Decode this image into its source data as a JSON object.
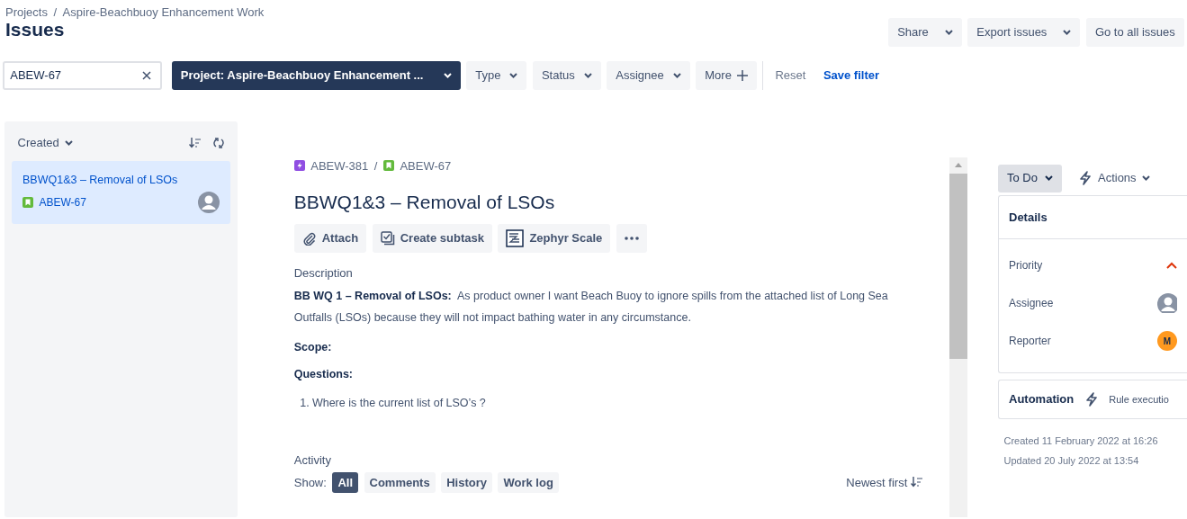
{
  "breadcrumb": [
    "Projects",
    "Aspire-Beachbuoy Enhancement Work"
  ],
  "breadcrumb_separator": "/",
  "page_title": "Issues",
  "header_buttons": [
    {
      "label": "Share",
      "dropdown": true
    },
    {
      "label": "Export issues",
      "dropdown": true
    },
    {
      "label": "Go to all issues",
      "dropdown": false
    }
  ],
  "search": {
    "value": "ABEW-67"
  },
  "filters": [
    {
      "label": "Project: Aspire-Beachbuoy Enhancement ...",
      "kind": "project"
    },
    {
      "label": "Type",
      "kind": "dropdown"
    },
    {
      "label": "Status",
      "kind": "dropdown"
    },
    {
      "label": "Assignee",
      "kind": "dropdown"
    },
    {
      "label": "More",
      "kind": "more"
    }
  ],
  "filter_links": [
    {
      "label": "Reset",
      "kind": "muted"
    },
    {
      "label": "Save filter",
      "kind": "primary"
    }
  ],
  "issue_list": {
    "sort_label": "Created",
    "items": [
      {
        "title": "BBWQ1&3 – Removal of LSOs",
        "key": "ABEW-67",
        "selected": true
      }
    ]
  },
  "issue": {
    "parent_key": "ABEW-381",
    "key_separator": "/",
    "key": "ABEW-67",
    "title": "BBWQ1&3 – Removal of LSOs",
    "actions": [
      {
        "label": "Attach",
        "kind": "attach"
      },
      {
        "label": "Create subtask",
        "kind": "subtask"
      },
      {
        "label": "Zephyr Scale",
        "kind": "zephyr"
      },
      {
        "kind": "more"
      }
    ],
    "description_label": "Description",
    "description": "**BB WQ 1 – Removal of LSOs:**  As product owner I want Beach Buoy to ignore spills from the attached list of Long Sea Outfalls (LSOs) because they will not impact bathing water in any circumstance.",
    "sections": [
      {
        "heading": "Scope:"
      },
      {
        "heading": "Questions:",
        "items": [
          {
            "number": "1.",
            "text": "Where is the current list of LSO’s ?"
          }
        ]
      }
    ],
    "activity": {
      "label": "Activity",
      "show_label": "Show:",
      "tabs": [
        {
          "label": "All",
          "selected": true
        },
        {
          "label": "Comments",
          "selected": false
        },
        {
          "label": "History",
          "selected": false
        },
        {
          "label": "Work log",
          "selected": false
        }
      ],
      "sort": "Newest first"
    }
  },
  "sidebar": {
    "status": "To Do",
    "actions": "Actions",
    "details_title": "Details",
    "fields": [
      {
        "label": "Priority",
        "kind": "priority"
      },
      {
        "label": "Assignee",
        "kind": "unassigned"
      },
      {
        "label": "Reporter",
        "kind": "initial",
        "initial": "M"
      }
    ],
    "automation": {
      "title": "Automation",
      "text": "Rule executio"
    },
    "created": "Created 11 February 2022 at 16:26",
    "updated": "Updated 20 July 2022 at 13:54"
  }
}
